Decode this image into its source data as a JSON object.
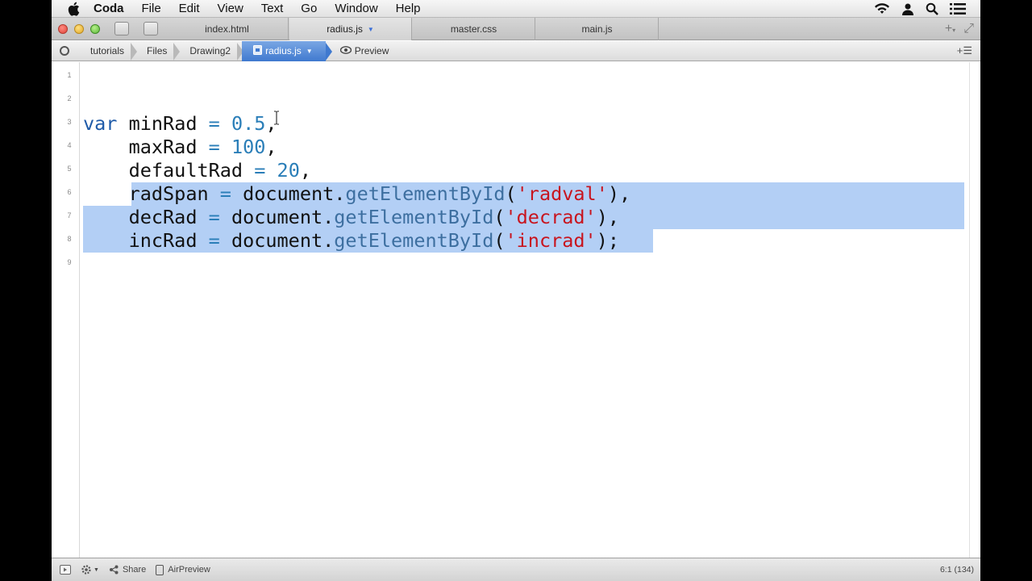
{
  "menubar": {
    "app_name": "Coda",
    "items": [
      "File",
      "Edit",
      "View",
      "Text",
      "Go",
      "Window",
      "Help"
    ],
    "status_icons": [
      "wifi-icon",
      "user-icon",
      "search-icon",
      "list-icon"
    ]
  },
  "tabs": [
    {
      "label": "index.html",
      "active": false
    },
    {
      "label": "radius.js",
      "active": true
    },
    {
      "label": "master.css",
      "active": false
    },
    {
      "label": "main.js",
      "active": false
    }
  ],
  "path": {
    "crumbs": [
      "tutorials",
      "Files",
      "Drawing2",
      "radius.js"
    ],
    "preview_label": "Preview"
  },
  "editor": {
    "line_numbers": [
      "1",
      "2",
      "3",
      "4",
      "5",
      "6",
      "7",
      "8",
      "9"
    ],
    "code_lines": [
      "",
      "",
      "var minRad = 0.5,",
      "    maxRad = 100,",
      "    defaultRad = 20,",
      "    radSpan = document.getElementById('radval'),",
      "    decRad = document.getElementById('decrad'),",
      "    incRad = document.getElementById('incrad');",
      ""
    ],
    "selection_lines": [
      6,
      7,
      8
    ]
  },
  "statusbar": {
    "share_label": "Share",
    "airpreview_label": "AirPreview",
    "cursor_position": "6:1 (134)"
  },
  "colors": {
    "keyword": "#1e5aa8",
    "number": "#2a7eb8",
    "string": "#c8141e",
    "selection": "#b3cff5",
    "active_crumb": "#3f79cf"
  }
}
